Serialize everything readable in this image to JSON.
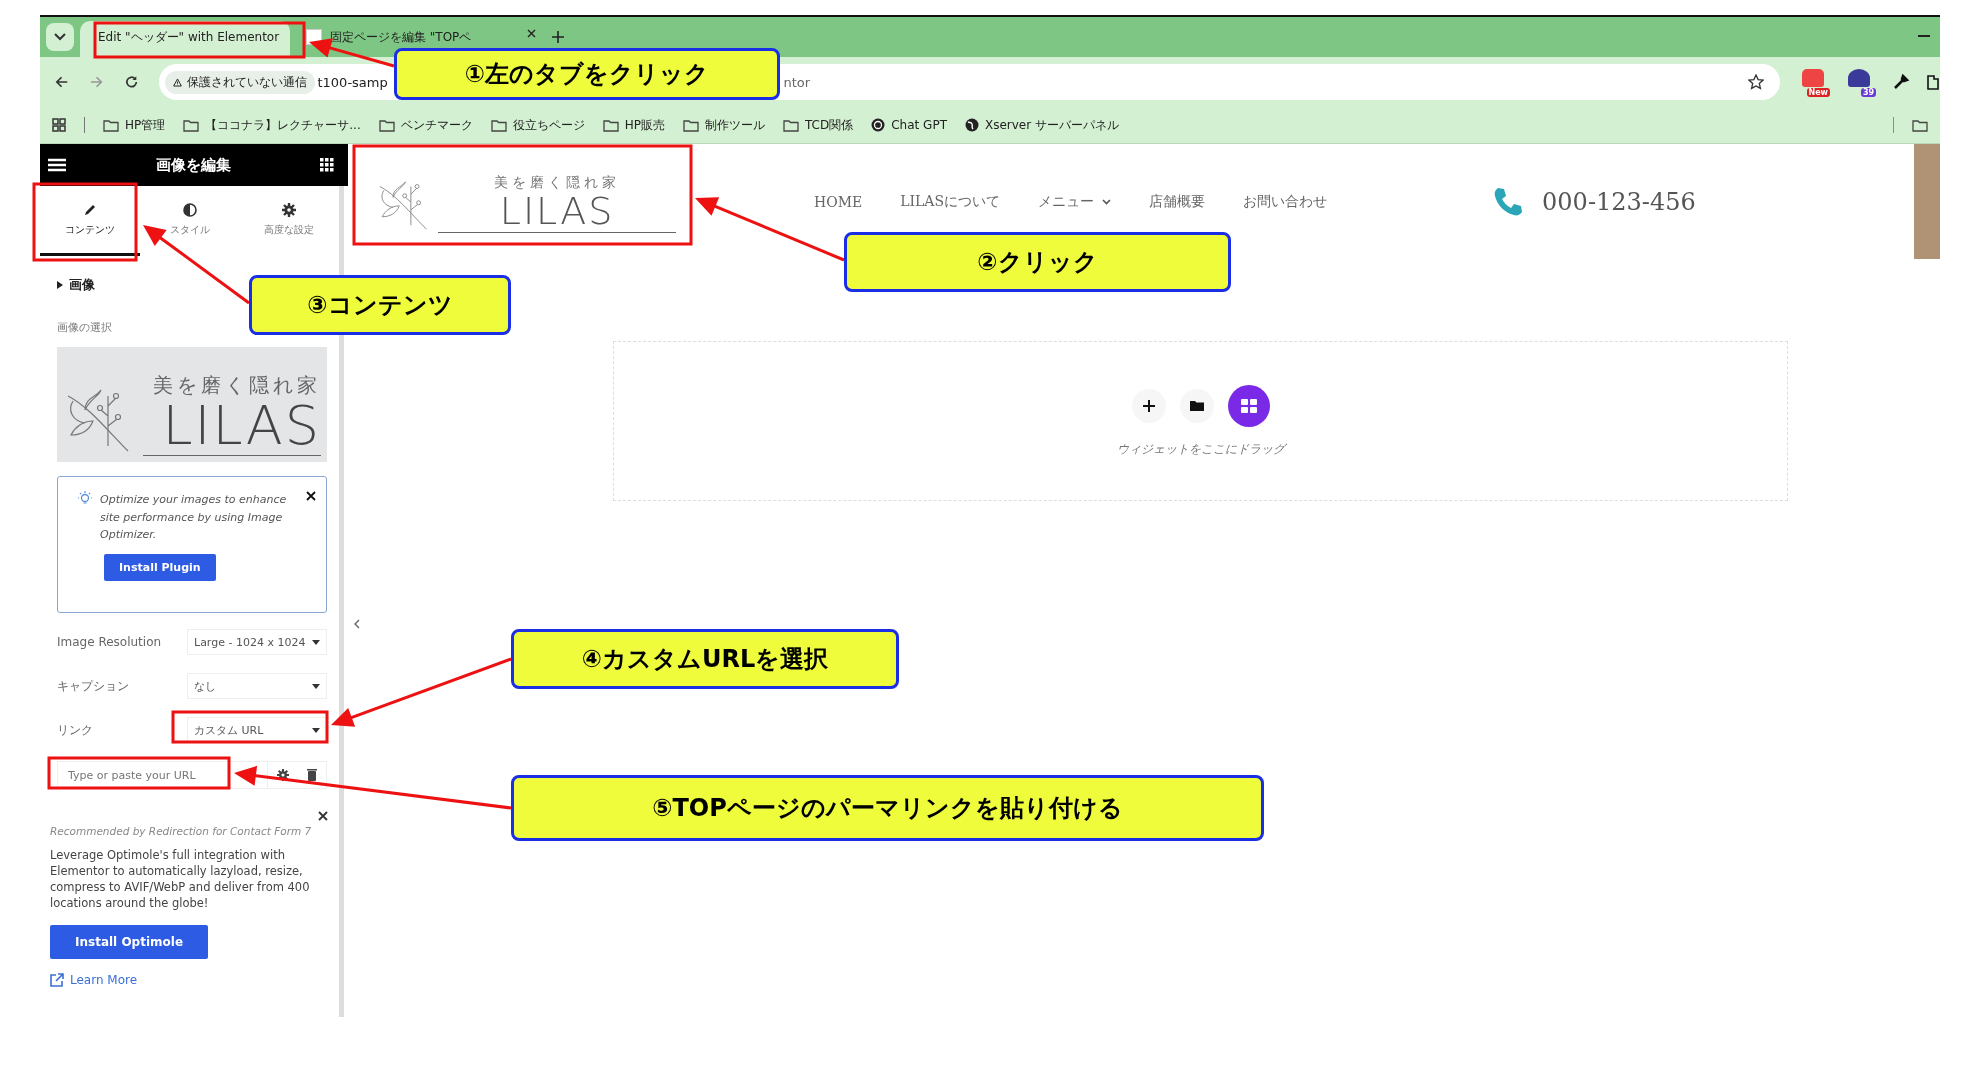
{
  "browser": {
    "tabs": [
      {
        "label": "Edit \"ヘッダー\" with Elementor",
        "selected": true
      },
      {
        "label": "固定ページを編集 \"TOPペ",
        "selected": false
      }
    ],
    "address": {
      "security": "保護されていない通信",
      "url_start": "t100-samp",
      "url_end": "ntor"
    },
    "extensions": [
      {
        "badge": "New"
      },
      {
        "badge": "39"
      }
    ],
    "bookmarks": [
      {
        "label": "HP管理",
        "kind": "folder"
      },
      {
        "label": "【ココナラ】レクチャーサ...",
        "kind": "folder"
      },
      {
        "label": "ベンチマーク",
        "kind": "folder"
      },
      {
        "label": "役立ちページ",
        "kind": "folder"
      },
      {
        "label": "HP販売",
        "kind": "folder"
      },
      {
        "label": "制作ツール",
        "kind": "folder"
      },
      {
        "label": "TCD関係",
        "kind": "folder"
      },
      {
        "label": "Chat GPT",
        "kind": "chat"
      },
      {
        "label": "Xserver サーバーパネル",
        "kind": "globe"
      }
    ]
  },
  "panel": {
    "title": "画像を編集",
    "tabs": [
      {
        "label": "コンテンツ",
        "kind": "pencil",
        "selected": true
      },
      {
        "label": "スタイル",
        "kind": "contrast",
        "selected": false
      },
      {
        "label": "高度な設定",
        "kind": "gear",
        "selected": false
      }
    ],
    "section": "画像",
    "image_label": "画像の選択",
    "logo": {
      "tagline": "美を磨く隠れ家",
      "name": "LILAS"
    },
    "notice": {
      "text": "Optimize your images to enhance site performance by using Image Optimizer.",
      "button": "Install Plugin"
    },
    "fields": [
      {
        "label": "Image Resolution",
        "value": "Large - 1024 x 1024"
      },
      {
        "label": "キャプション",
        "value": "なし"
      },
      {
        "label": "リンク",
        "value": "カスタム URL"
      }
    ],
    "url_placeholder": "Type or paste your URL",
    "promo": {
      "recommended": "Recommended by Redirection for Contact Form 7",
      "text": "Leverage Optimole's full integration with Elementor to automatically lazyload, resize, compress to AVIF/WebP and deliver from 400 locations around the globe!",
      "button": "Install Optimole",
      "link": "Learn More"
    }
  },
  "page": {
    "logo": {
      "tagline": "美を磨く隠れ家",
      "name": "LILAS"
    },
    "nav": [
      {
        "label": "HOME",
        "dropdown": false
      },
      {
        "label": "LILASについて",
        "dropdown": false
      },
      {
        "label": "メニュー",
        "dropdown": true
      },
      {
        "label": "店舗概要",
        "dropdown": false
      },
      {
        "label": "お問い合わせ",
        "dropdown": false
      }
    ],
    "phone": "000-123-456",
    "drop_hint": "ウィジェットをここにドラッグ"
  },
  "annotations": [
    {
      "text": "①左のタブをクリック"
    },
    {
      "text": "②クリック"
    },
    {
      "text": "③コンテンツ"
    },
    {
      "text": "④カスタムURLを選択"
    },
    {
      "text": "⑤TOPページのパーマリンクを貼り付ける"
    }
  ]
}
